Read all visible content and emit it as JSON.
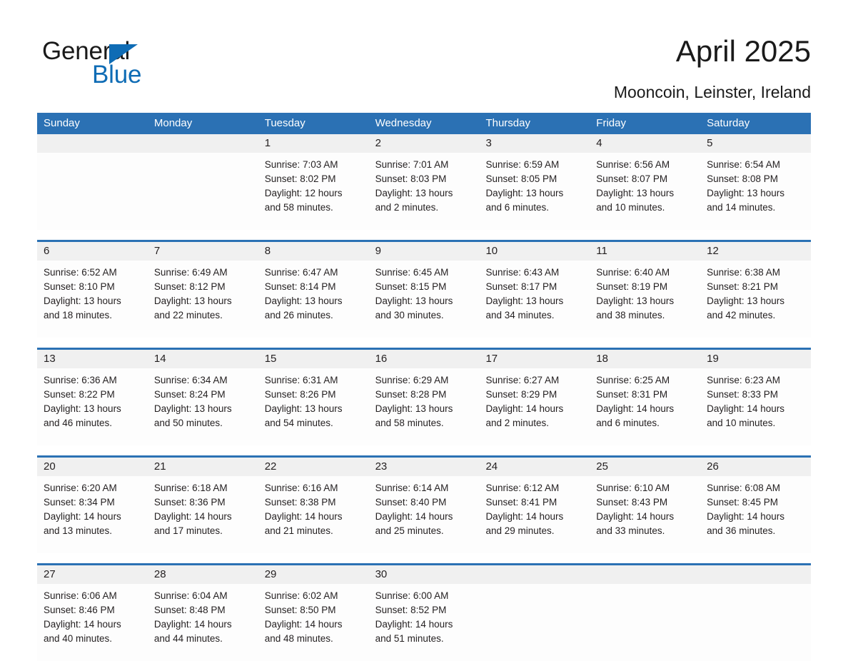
{
  "brand": {
    "name_part1": "General",
    "name_part2": "Blue",
    "triangle_icon": "blue-triangle-icon",
    "accent_color": "#0f6cb5"
  },
  "header": {
    "title": "April 2025",
    "subtitle": "Mooncoin, Leinster, Ireland"
  },
  "theme": {
    "header_blue": "#2b71b4",
    "daynum_band": "#f0f0f0",
    "cell_background": "#fdfdfd",
    "text_color": "#231f20"
  },
  "calendar": {
    "weekdays": [
      "Sunday",
      "Monday",
      "Tuesday",
      "Wednesday",
      "Thursday",
      "Friday",
      "Saturday"
    ],
    "weeks": [
      {
        "days": [
          {
            "num": "",
            "lines": [
              "",
              "",
              "",
              ""
            ]
          },
          {
            "num": "",
            "lines": [
              "",
              "",
              "",
              ""
            ]
          },
          {
            "num": "1",
            "lines": [
              "Sunrise: 7:03 AM",
              "Sunset: 8:02 PM",
              "Daylight: 12 hours",
              "and 58 minutes."
            ]
          },
          {
            "num": "2",
            "lines": [
              "Sunrise: 7:01 AM",
              "Sunset: 8:03 PM",
              "Daylight: 13 hours",
              "and 2 minutes."
            ]
          },
          {
            "num": "3",
            "lines": [
              "Sunrise: 6:59 AM",
              "Sunset: 8:05 PM",
              "Daylight: 13 hours",
              "and 6 minutes."
            ]
          },
          {
            "num": "4",
            "lines": [
              "Sunrise: 6:56 AM",
              "Sunset: 8:07 PM",
              "Daylight: 13 hours",
              "and 10 minutes."
            ]
          },
          {
            "num": "5",
            "lines": [
              "Sunrise: 6:54 AM",
              "Sunset: 8:08 PM",
              "Daylight: 13 hours",
              "and 14 minutes."
            ]
          }
        ]
      },
      {
        "days": [
          {
            "num": "6",
            "lines": [
              "Sunrise: 6:52 AM",
              "Sunset: 8:10 PM",
              "Daylight: 13 hours",
              "and 18 minutes."
            ]
          },
          {
            "num": "7",
            "lines": [
              "Sunrise: 6:49 AM",
              "Sunset: 8:12 PM",
              "Daylight: 13 hours",
              "and 22 minutes."
            ]
          },
          {
            "num": "8",
            "lines": [
              "Sunrise: 6:47 AM",
              "Sunset: 8:14 PM",
              "Daylight: 13 hours",
              "and 26 minutes."
            ]
          },
          {
            "num": "9",
            "lines": [
              "Sunrise: 6:45 AM",
              "Sunset: 8:15 PM",
              "Daylight: 13 hours",
              "and 30 minutes."
            ]
          },
          {
            "num": "10",
            "lines": [
              "Sunrise: 6:43 AM",
              "Sunset: 8:17 PM",
              "Daylight: 13 hours",
              "and 34 minutes."
            ]
          },
          {
            "num": "11",
            "lines": [
              "Sunrise: 6:40 AM",
              "Sunset: 8:19 PM",
              "Daylight: 13 hours",
              "and 38 minutes."
            ]
          },
          {
            "num": "12",
            "lines": [
              "Sunrise: 6:38 AM",
              "Sunset: 8:21 PM",
              "Daylight: 13 hours",
              "and 42 minutes."
            ]
          }
        ]
      },
      {
        "days": [
          {
            "num": "13",
            "lines": [
              "Sunrise: 6:36 AM",
              "Sunset: 8:22 PM",
              "Daylight: 13 hours",
              "and 46 minutes."
            ]
          },
          {
            "num": "14",
            "lines": [
              "Sunrise: 6:34 AM",
              "Sunset: 8:24 PM",
              "Daylight: 13 hours",
              "and 50 minutes."
            ]
          },
          {
            "num": "15",
            "lines": [
              "Sunrise: 6:31 AM",
              "Sunset: 8:26 PM",
              "Daylight: 13 hours",
              "and 54 minutes."
            ]
          },
          {
            "num": "16",
            "lines": [
              "Sunrise: 6:29 AM",
              "Sunset: 8:28 PM",
              "Daylight: 13 hours",
              "and 58 minutes."
            ]
          },
          {
            "num": "17",
            "lines": [
              "Sunrise: 6:27 AM",
              "Sunset: 8:29 PM",
              "Daylight: 14 hours",
              "and 2 minutes."
            ]
          },
          {
            "num": "18",
            "lines": [
              "Sunrise: 6:25 AM",
              "Sunset: 8:31 PM",
              "Daylight: 14 hours",
              "and 6 minutes."
            ]
          },
          {
            "num": "19",
            "lines": [
              "Sunrise: 6:23 AM",
              "Sunset: 8:33 PM",
              "Daylight: 14 hours",
              "and 10 minutes."
            ]
          }
        ]
      },
      {
        "days": [
          {
            "num": "20",
            "lines": [
              "Sunrise: 6:20 AM",
              "Sunset: 8:34 PM",
              "Daylight: 14 hours",
              "and 13 minutes."
            ]
          },
          {
            "num": "21",
            "lines": [
              "Sunrise: 6:18 AM",
              "Sunset: 8:36 PM",
              "Daylight: 14 hours",
              "and 17 minutes."
            ]
          },
          {
            "num": "22",
            "lines": [
              "Sunrise: 6:16 AM",
              "Sunset: 8:38 PM",
              "Daylight: 14 hours",
              "and 21 minutes."
            ]
          },
          {
            "num": "23",
            "lines": [
              "Sunrise: 6:14 AM",
              "Sunset: 8:40 PM",
              "Daylight: 14 hours",
              "and 25 minutes."
            ]
          },
          {
            "num": "24",
            "lines": [
              "Sunrise: 6:12 AM",
              "Sunset: 8:41 PM",
              "Daylight: 14 hours",
              "and 29 minutes."
            ]
          },
          {
            "num": "25",
            "lines": [
              "Sunrise: 6:10 AM",
              "Sunset: 8:43 PM",
              "Daylight: 14 hours",
              "and 33 minutes."
            ]
          },
          {
            "num": "26",
            "lines": [
              "Sunrise: 6:08 AM",
              "Sunset: 8:45 PM",
              "Daylight: 14 hours",
              "and 36 minutes."
            ]
          }
        ]
      },
      {
        "days": [
          {
            "num": "27",
            "lines": [
              "Sunrise: 6:06 AM",
              "Sunset: 8:46 PM",
              "Daylight: 14 hours",
              "and 40 minutes."
            ]
          },
          {
            "num": "28",
            "lines": [
              "Sunrise: 6:04 AM",
              "Sunset: 8:48 PM",
              "Daylight: 14 hours",
              "and 44 minutes."
            ]
          },
          {
            "num": "29",
            "lines": [
              "Sunrise: 6:02 AM",
              "Sunset: 8:50 PM",
              "Daylight: 14 hours",
              "and 48 minutes."
            ]
          },
          {
            "num": "30",
            "lines": [
              "Sunrise: 6:00 AM",
              "Sunset: 8:52 PM",
              "Daylight: 14 hours",
              "and 51 minutes."
            ]
          },
          {
            "num": "",
            "lines": [
              "",
              "",
              "",
              ""
            ]
          },
          {
            "num": "",
            "lines": [
              "",
              "",
              "",
              ""
            ]
          },
          {
            "num": "",
            "lines": [
              "",
              "",
              "",
              ""
            ]
          }
        ]
      }
    ]
  }
}
